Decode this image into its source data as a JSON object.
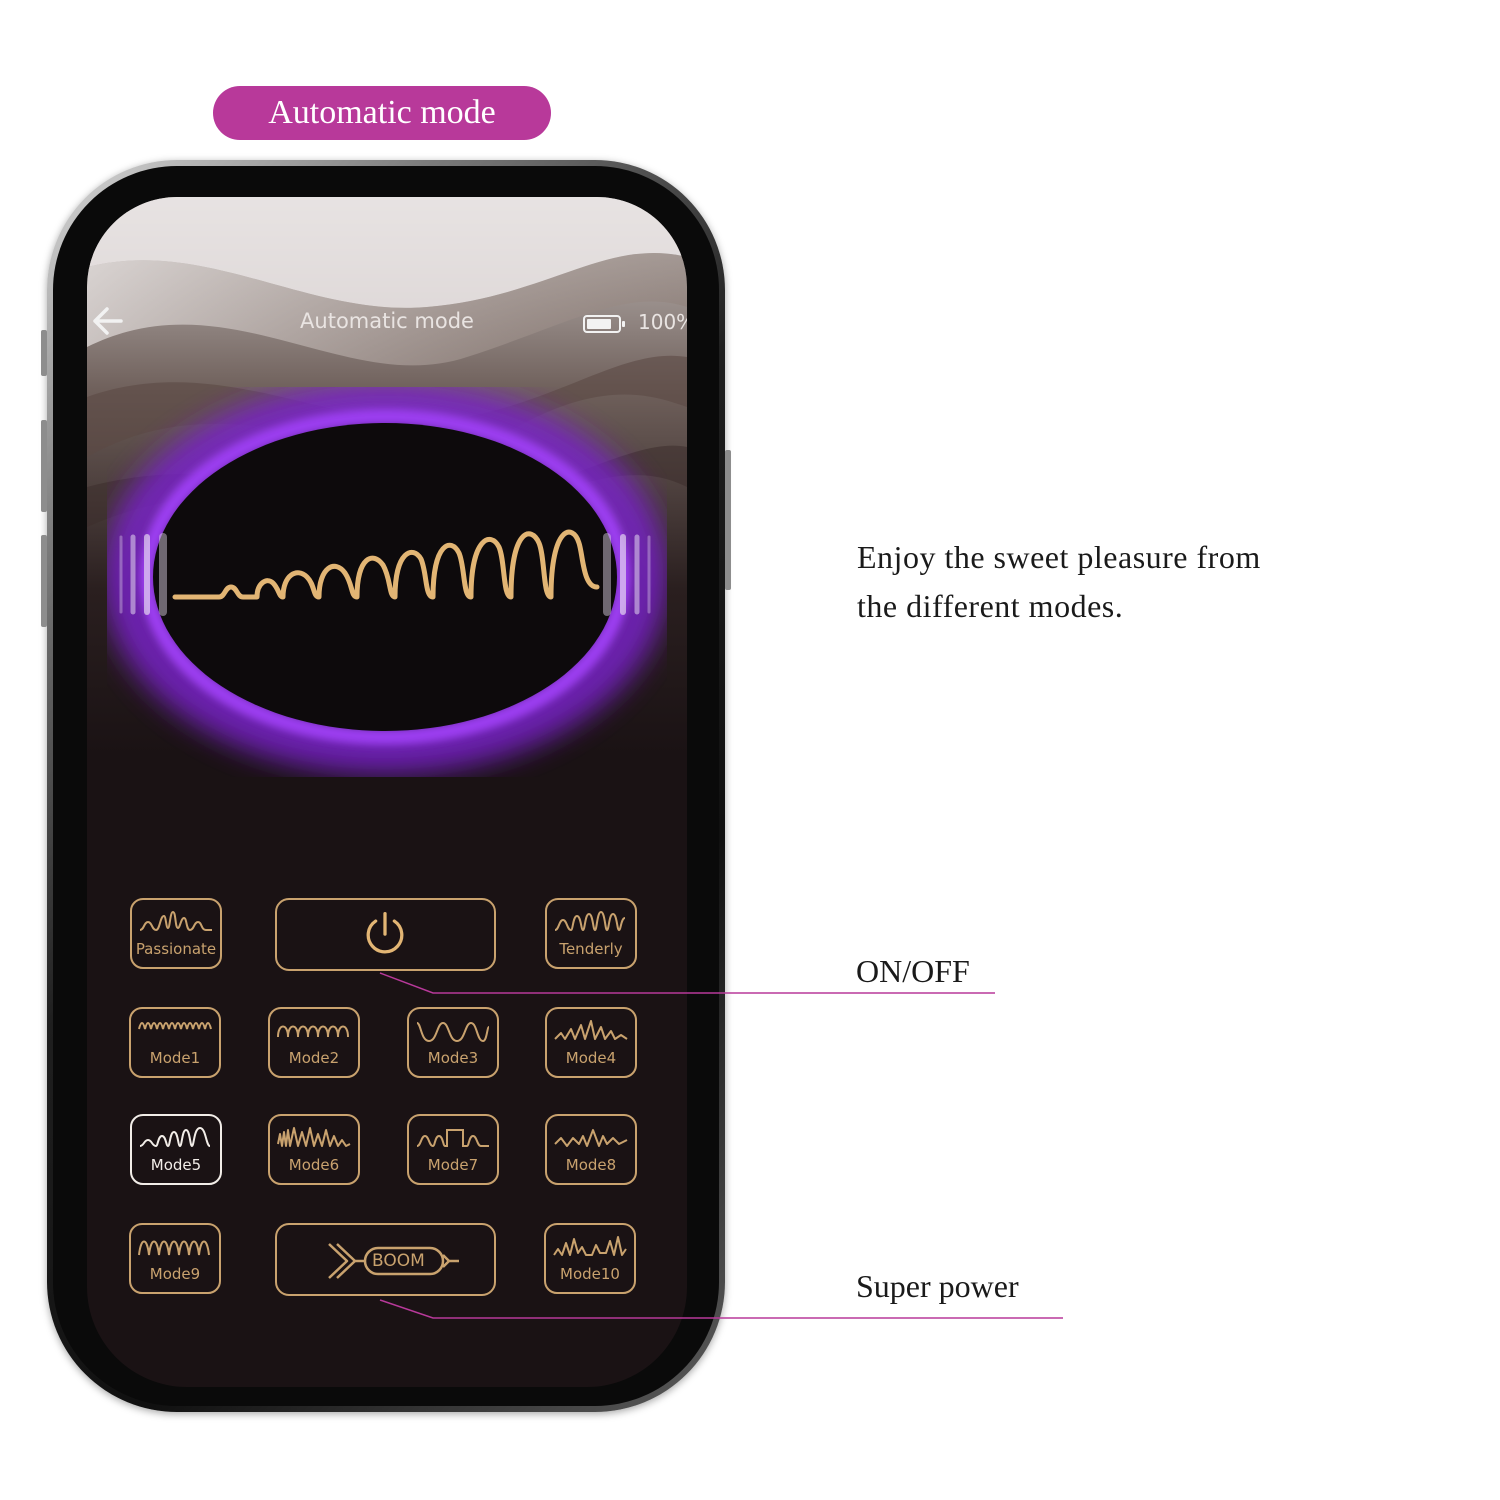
{
  "banner": {
    "label": "Automatic mode"
  },
  "app": {
    "title": "Automatic mode",
    "battery_text": "100%",
    "accent": "#c9a26e",
    "glow": "#8a2bd9"
  },
  "controls": {
    "passionate": "Passionate",
    "tenderly": "Tenderly",
    "boom": "BOOM",
    "modes": [
      "Mode1",
      "Mode2",
      "Mode3",
      "Mode4",
      "Mode5",
      "Mode6",
      "Mode7",
      "Mode8",
      "Mode9",
      "Mode10"
    ],
    "active_mode": "Mode5"
  },
  "annotations": {
    "description_line1": "Enjoy the sweet pleasure from",
    "description_line2": "the different modes.",
    "on_off": "ON/OFF",
    "super_power": "Super power",
    "line_color": "#b8399a"
  }
}
